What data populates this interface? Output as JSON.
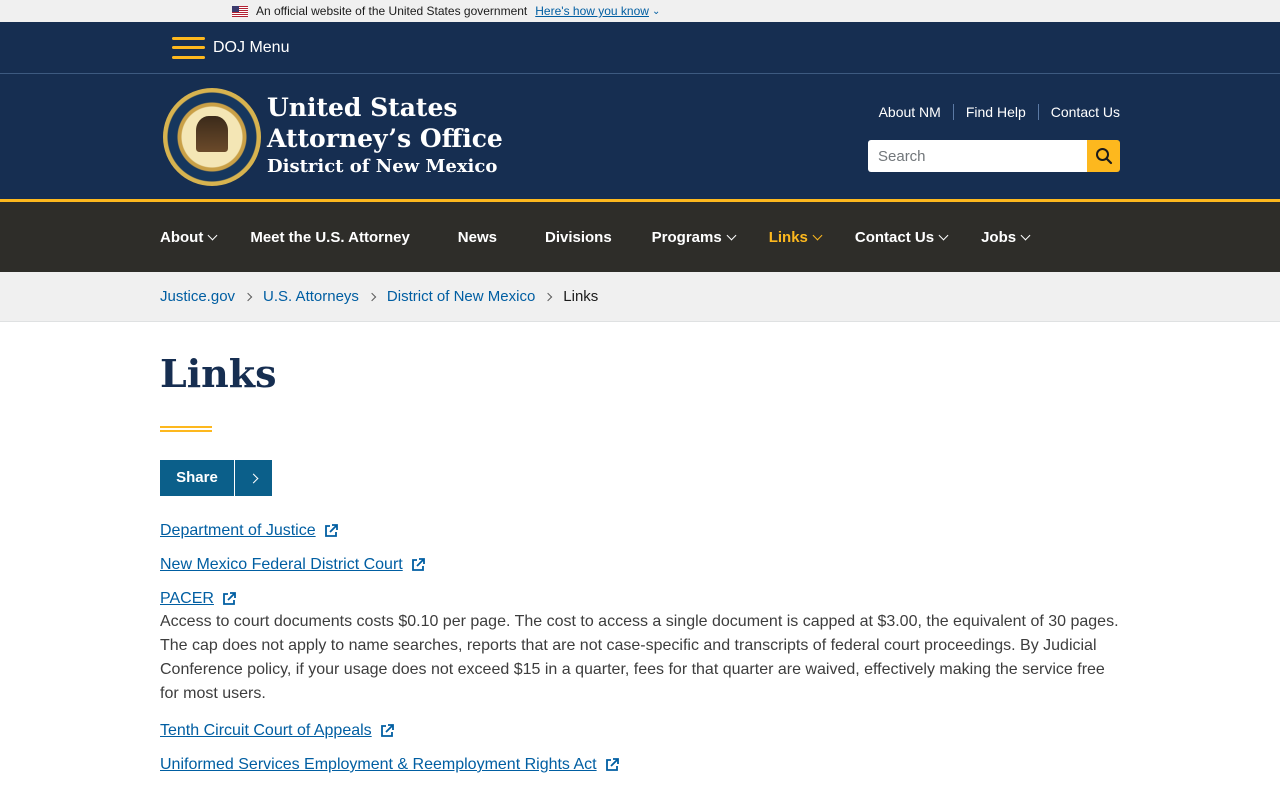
{
  "gov_banner": {
    "text": "An official website of the United States government",
    "link": "Here's how you know"
  },
  "doj_menu": {
    "label": "DOJ Menu"
  },
  "header": {
    "office_line1": "United States",
    "office_line2": "Attorney’s Office",
    "office_line3": "District of New Mexico",
    "util_links": [
      "About NM",
      "Find Help",
      "Contact Us"
    ],
    "search_placeholder": "Search"
  },
  "nav": {
    "items": [
      {
        "label": "About",
        "caret": true
      },
      {
        "label": "Meet the U.S. Attorney",
        "caret": false
      },
      {
        "label": "News",
        "caret": false
      },
      {
        "label": "Divisions",
        "caret": false
      },
      {
        "label": "Programs",
        "caret": true
      },
      {
        "label": "Links",
        "caret": true,
        "active": true
      },
      {
        "label": "Contact Us",
        "caret": true
      },
      {
        "label": "Jobs",
        "caret": true
      }
    ]
  },
  "breadcrumb": {
    "items": [
      "Justice.gov",
      "U.S. Attorneys",
      "District of New Mexico"
    ],
    "current": "Links"
  },
  "page": {
    "title": "Links",
    "share_label": "Share"
  },
  "links": [
    {
      "label": "Department of Justice",
      "description": ""
    },
    {
      "label": "New Mexico Federal District Court",
      "description": ""
    },
    {
      "label": "PACER",
      "description": "Access to court documents costs $0.10 per page. The cost to access a single document is capped at $3.00, the equivalent of 30 pages. The cap does not apply to name searches, reports that are not case-specific and transcripts of federal court proceedings. By Judicial Conference policy, if your usage does not exceed $15 in a quarter, fees for that quarter are waived, effectively making the service free for most users."
    },
    {
      "label": "Tenth Circuit Court of Appeals",
      "description": ""
    },
    {
      "label": "Uniformed Services Employment & Reemployment Rights Act",
      "description": ""
    }
  ],
  "colors": {
    "header_bg": "#162e51",
    "nav_bg": "#2e2d29",
    "accent": "#fdb81e",
    "link": "#005ea2"
  }
}
